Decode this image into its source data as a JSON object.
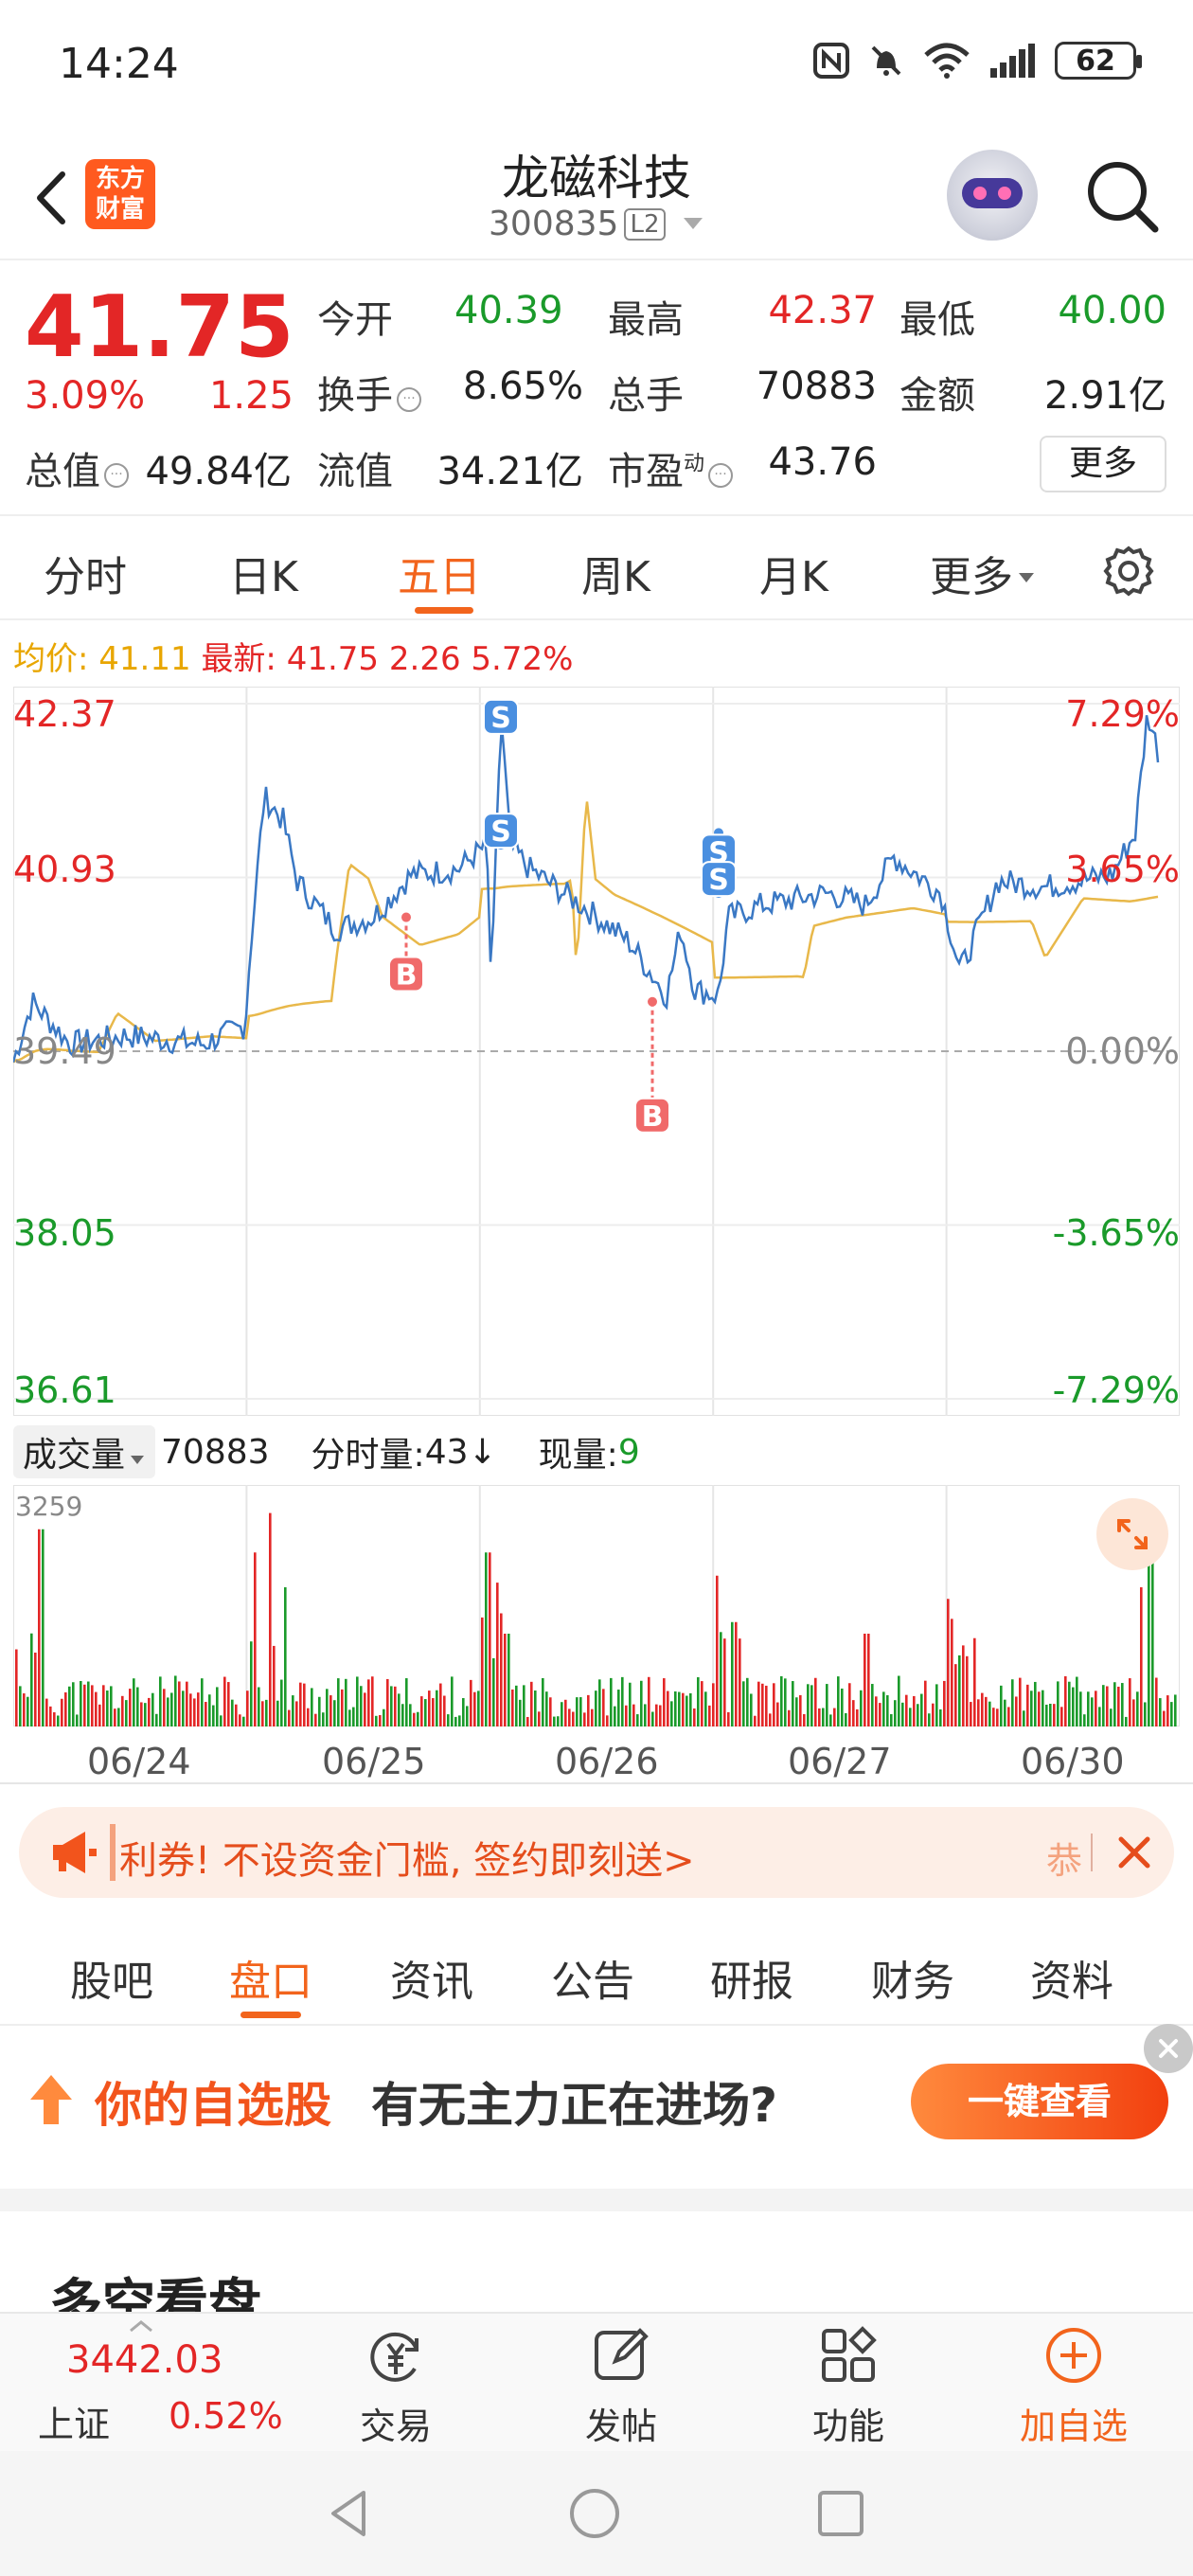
{
  "status_bar": {
    "time": "14:24",
    "battery": "62",
    "icons": [
      "nfc-icon",
      "mute-icon",
      "wifi-icon",
      "signal-icon",
      "battery-icon"
    ]
  },
  "header": {
    "brand_logo": "东方财富",
    "stock_name": "龙磁科技",
    "stock_code": "300835",
    "level_badge": "L2"
  },
  "quote": {
    "price": "41.75",
    "change_pct": "3.09%",
    "change_value": "1.25",
    "open_label": "今开",
    "open": "40.39",
    "high_label": "最高",
    "high": "42.37",
    "low_label": "最低",
    "low": "40.00",
    "turnover_label": "换手",
    "turnover": "8.65%",
    "volume_label": "总手",
    "volume": "70883",
    "amount_label": "金额",
    "amount": "2.91亿",
    "mktcap_label": "总值",
    "mktcap": "49.84亿",
    "float_label": "流值",
    "float_cap": "34.21亿",
    "pe_label": "市盈",
    "pe_sup": "动",
    "pe": "43.76",
    "more_button": "更多"
  },
  "period_tabs": [
    "分时",
    "日K",
    "五日",
    "周K",
    "月K",
    "更多"
  ],
  "active_period": "五日",
  "avg_line": {
    "avg_label": "均价:",
    "avg_value": "41.11",
    "latest_label": "最新:",
    "latest_value": "41.75",
    "latest_change": "2.26",
    "latest_pct": "5.72%"
  },
  "chart_data": [
    {
      "type": "line",
      "x": [
        "06/24",
        "06/25",
        "06/26",
        "06/27",
        "06/30"
      ],
      "series": [],
      "ylim": [
        36.61,
        42.37
      ],
      "y_ticks_left": [
        "42.37",
        "40.93",
        "39.49",
        "38.05",
        "36.61"
      ],
      "y_ticks_right": [
        "7.29%",
        "3.65%",
        "0.00%",
        "-3.65%",
        "-7.29%"
      ],
      "trade_markers": [
        {
          "label": "B",
          "day": "06/25",
          "price": 40.6
        },
        {
          "label": "S",
          "day": "06/25",
          "price": 42.3
        },
        {
          "label": "S",
          "day": "06/25",
          "price": 41.2
        },
        {
          "label": "B",
          "day": "06/26",
          "price": 39.9
        },
        {
          "label": "S",
          "day": "06/27",
          "price": 41.3
        },
        {
          "label": "S",
          "day": "06/27",
          "price": 40.8
        }
      ]
    },
    {
      "type": "bar",
      "title": "成交量",
      "x": [
        "06/24",
        "06/25",
        "06/26",
        "06/27",
        "06/30"
      ],
      "ylim": [
        0,
        3259
      ],
      "series": [
        {
          "name": "成交量",
          "values": []
        }
      ]
    }
  ],
  "volume_header": {
    "select_label": "成交量",
    "total": "70883",
    "tick_label": "分时量:",
    "tick_value": "43",
    "now_label": "现量:",
    "now_value": "9",
    "max_label": "3259"
  },
  "dates": [
    "06/24",
    "06/25",
    "06/26",
    "06/27",
    "06/30"
  ],
  "promo": {
    "text": "利券! 不设资金门槛, 签约即刻送>",
    "tail": "恭"
  },
  "section_tabs": [
    "股吧",
    "盘口",
    "资讯",
    "公告",
    "研报",
    "财务",
    "资料"
  ],
  "active_section": "盘口",
  "watch_ad": {
    "highlight": "你的自选股",
    "text": "有无主力正在进场?",
    "button": "一键查看"
  },
  "section_heading": "多空看盘",
  "bottom_nav": {
    "index_value": "3442.03",
    "index_name": "上证",
    "index_pct": "0.52%",
    "items": [
      {
        "label": "交易",
        "icon": "yuan-exchange-icon"
      },
      {
        "label": "发帖",
        "icon": "edit-icon"
      },
      {
        "label": "功能",
        "icon": "grid-icon"
      },
      {
        "label": "加自选",
        "icon": "add-circle-icon"
      }
    ]
  },
  "colors": {
    "up": "#e32626",
    "down": "#1a9a2a",
    "accent": "#f2641c",
    "avg_line": "#e8b84a",
    "price_line": "#3a78c4"
  }
}
